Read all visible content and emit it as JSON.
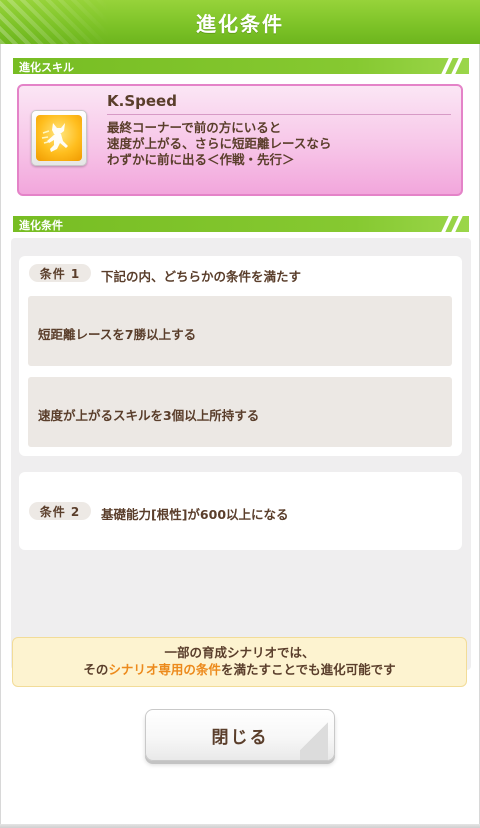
{
  "header": {
    "title": "進化条件"
  },
  "skill_section": {
    "label": "進化スキル",
    "skill": {
      "name": "K.Speed",
      "icon": "speed-runner-icon",
      "description": [
        "最終コーナーで前の方にいると",
        "速度が上がる、さらに短距離レースなら",
        "わずかに前に出る＜作戦・先行＞"
      ]
    }
  },
  "conditions_section": {
    "label": "進化条件",
    "conditions": [
      {
        "badge": "条件 1",
        "text": "下記の内、どちらかの条件を満たす",
        "sub": [
          "短距離レースを7勝以上する",
          "速度が上がるスキルを3個以上所持する"
        ]
      },
      {
        "badge": "条件 2",
        "text": "基礎能力[根性]が600以上になる"
      }
    ]
  },
  "notice": {
    "line1": "一部の育成シナリオでは、",
    "line2_pre": "その",
    "line2_highlight": "シナリオ専用の条件",
    "line2_post": "を満たすことでも進化可能です"
  },
  "close_button": {
    "label": "閉じる"
  },
  "colors": {
    "header_green": "#7cc227",
    "skill_card_pink": "#f7c6e8",
    "notice_yellow": "#fdf3d0",
    "highlight_orange": "#ec8a1c",
    "text_brown": "#5a3e2b"
  }
}
